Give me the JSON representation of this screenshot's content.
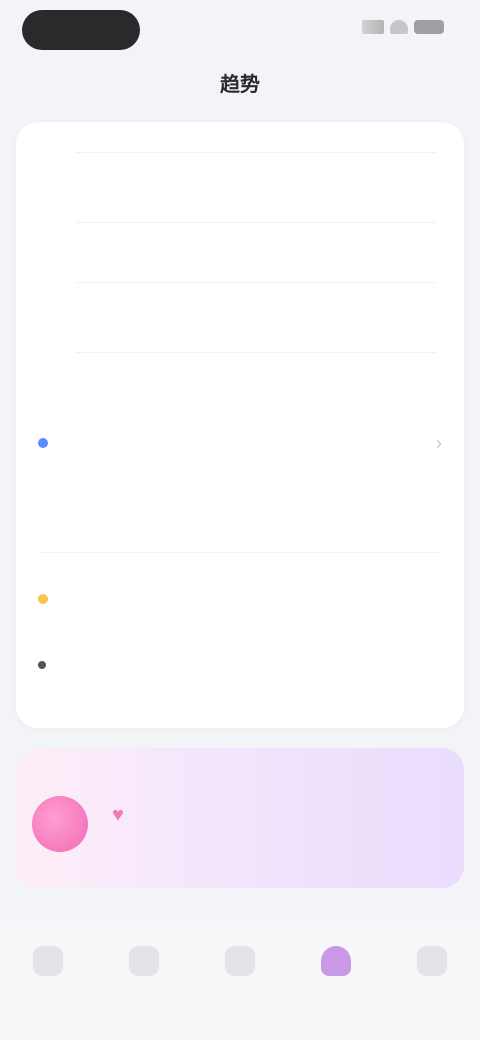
{
  "status_bar": {
    "signal_icon": "signal-icon",
    "wifi_icon": "wifi-icon",
    "battery_icon": "battery-icon"
  },
  "header": {
    "title": "趋势"
  },
  "chart_card": {
    "y_ticks": [
      "",
      "",
      ""
    ],
    "empty_message": "",
    "link_text": "",
    "x_ticks": [
      "",
      "",
      "",
      "",
      "",
      ""
    ]
  },
  "section": {
    "title": "",
    "subtitle": ""
  },
  "row1": {
    "label": "",
    "value": ""
  },
  "row2": {
    "label": "",
    "note": ""
  },
  "promo": {
    "title": "",
    "subtitle": ""
  },
  "nav": {
    "items": [
      {
        "label": "",
        "icon": "home-icon"
      },
      {
        "label": "",
        "icon": "calendar-icon"
      },
      {
        "label": "",
        "icon": "record-icon"
      },
      {
        "label": "",
        "icon": "trend-icon",
        "active": true
      },
      {
        "label": "",
        "icon": "profile-icon"
      }
    ]
  },
  "colors": {
    "accent": "#c46be8",
    "blue_dot": "#5b8cff",
    "yellow_dot": "#f5c64a",
    "promo_pink": "#f06ab4"
  }
}
